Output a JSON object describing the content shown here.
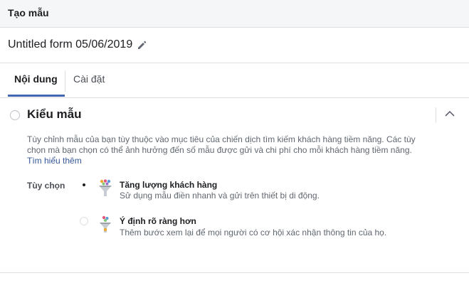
{
  "header": {
    "title": "Tạo mẫu"
  },
  "form": {
    "name": "Untitled form 05/06/2019",
    "edit_icon": "pencil-icon"
  },
  "tabs": [
    {
      "label": "Nội dung",
      "active": true
    },
    {
      "label": "Cài đặt",
      "active": false
    }
  ],
  "section": {
    "title": "Kiểu mẫu",
    "collapse_icon": "chevron-up-icon",
    "description": "Tùy chỉnh mẫu của bạn tùy thuộc vào mục tiêu của chiến dịch tìm kiếm khách hàng tiềm năng. Các tùy chọn mà bạn chọn có thể ảnh hưởng đến số mẫu được gửi và chi phí cho mỗi khách hàng tiềm năng. ",
    "learn_more": "Tìm hiểu thêm",
    "options_label": "Tùy chọn",
    "options": [
      {
        "title": "Tăng lượng khách hàng",
        "subtitle": "Sử dụng mẫu điền nhanh và gửi trên thiết bị di động.",
        "selected": true,
        "icon": "funnel-wide-icon"
      },
      {
        "title": "Ý định rõ ràng hơn",
        "subtitle": "Thêm bước xem lại để mọi người có cơ hội xác nhận thông tin của họ.",
        "selected": false,
        "icon": "funnel-narrow-icon"
      }
    ]
  },
  "colors": {
    "accent": "#4267b2",
    "link": "#365899",
    "muted": "#606770"
  }
}
